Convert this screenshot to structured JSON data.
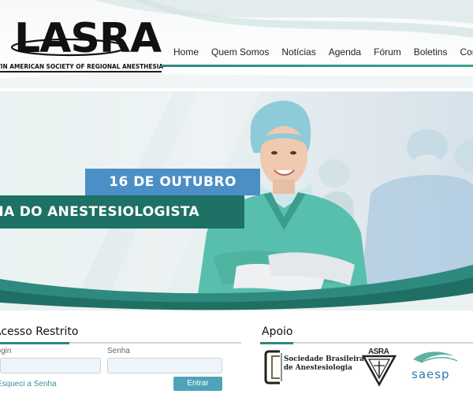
{
  "logo": {
    "name": "LASRA",
    "tagline": "LATIN AMERICAN SOCIETY OF REGIONAL ANESTHESIA"
  },
  "nav": {
    "items": [
      {
        "label": "Home"
      },
      {
        "label": "Quem Somos"
      },
      {
        "label": "Notícias"
      },
      {
        "label": "Agenda"
      },
      {
        "label": "Fórum"
      },
      {
        "label": "Boletins"
      },
      {
        "label": "Contato"
      }
    ]
  },
  "banner": {
    "date": "16 DE OUTUBRO",
    "title": "DIA DO ANESTESIOLOGISTA"
  },
  "restrito": {
    "title": "Acesso Restrito",
    "login_label": "Login",
    "password_label": "Senha",
    "forgot_link": "Esqueci a Senha",
    "submit_label": "Entrar"
  },
  "apoio": {
    "title": "Apoio",
    "sponsors": [
      {
        "name": "Sociedade Brasileira",
        "name2": "de Anestesiologia"
      },
      {
        "name": "ASRA"
      },
      {
        "name": "saesp"
      }
    ]
  },
  "colors": {
    "teal": "#1d7165",
    "teal_accent": "#2e8a7e",
    "blue": "#4c8fc6",
    "button": "#4ea3b8"
  }
}
